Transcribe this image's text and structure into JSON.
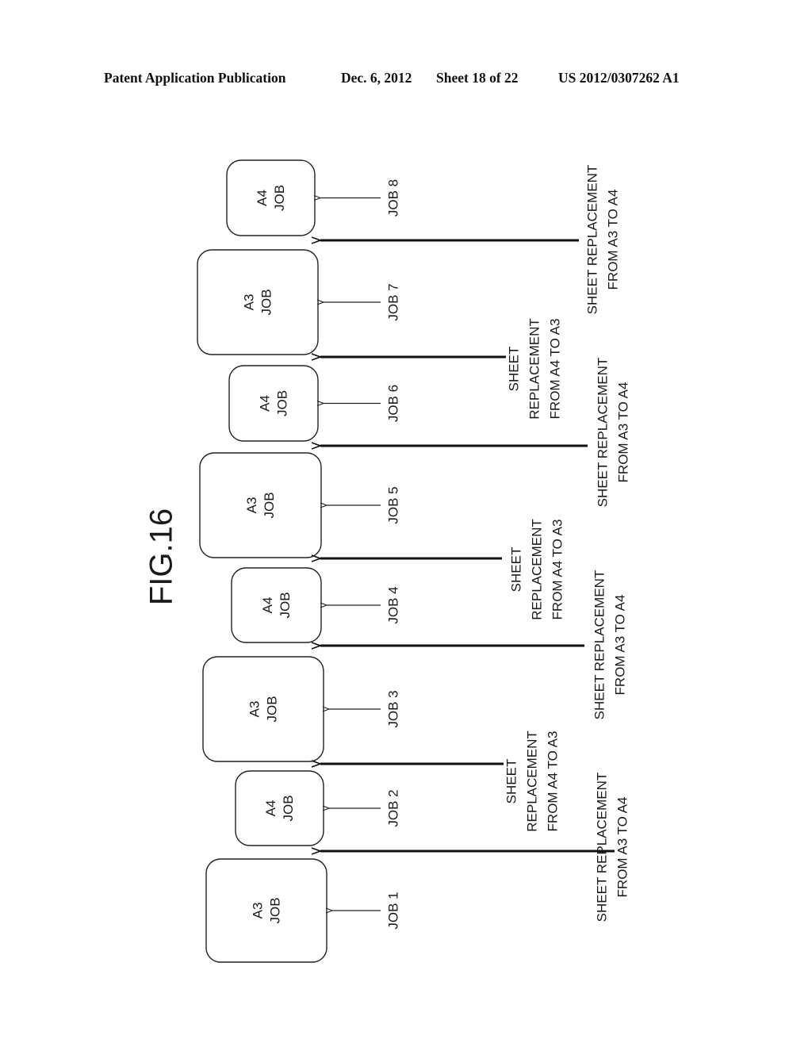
{
  "header": {
    "publication": "Patent Application Publication",
    "date": "Dec. 6, 2012",
    "sheet": "Sheet 18 of 22",
    "number": "US 2012/0307262 A1"
  },
  "figure": {
    "title": "FIG.16",
    "jobs": [
      {
        "id": "job-1",
        "size": "A3",
        "line1": "A3",
        "line2": "JOB",
        "label": "JOB 1"
      },
      {
        "id": "job-2",
        "size": "A4",
        "line1": "A4",
        "line2": "JOB",
        "label": "JOB 2"
      },
      {
        "id": "job-3",
        "size": "A3",
        "line1": "A3",
        "line2": "JOB",
        "label": "JOB 3"
      },
      {
        "id": "job-4",
        "size": "A4",
        "line1": "A4",
        "line2": "JOB",
        "label": "JOB 4"
      },
      {
        "id": "job-5",
        "size": "A3",
        "line1": "A3",
        "line2": "JOB",
        "label": "JOB 5"
      },
      {
        "id": "job-6",
        "size": "A4",
        "line1": "A4",
        "line2": "JOB",
        "label": "JOB 6"
      },
      {
        "id": "job-7",
        "size": "A3",
        "line1": "A3",
        "line2": "JOB",
        "label": "JOB 7"
      },
      {
        "id": "job-8",
        "size": "A4",
        "line1": "A4",
        "line2": "JOB",
        "label": "JOB 8"
      }
    ],
    "replacements": [
      {
        "between": "job-1/job-2",
        "lines": [
          "SHEET REPLACEMENT",
          "FROM A3 TO A4"
        ]
      },
      {
        "between": "job-2/job-3",
        "lines": [
          "SHEET",
          "REPLACEMENT",
          "FROM A4 TO A3"
        ]
      },
      {
        "between": "job-3/job-4",
        "lines": [
          "SHEET REPLACEMENT",
          "FROM A3 TO A4"
        ]
      },
      {
        "between": "job-4/job-5",
        "lines": [
          "SHEET",
          "REPLACEMENT",
          "FROM A4 TO A3"
        ]
      },
      {
        "between": "job-5/job-6",
        "lines": [
          "SHEET REPLACEMENT",
          "FROM A3 TO A4"
        ]
      },
      {
        "between": "job-6/job-7",
        "lines": [
          "SHEET",
          "REPLACEMENT",
          "FROM A4 TO A3"
        ]
      },
      {
        "between": "job-7/job-8",
        "lines": [
          "SHEET REPLACEMENT",
          "FROM A3 TO A4"
        ]
      }
    ]
  }
}
